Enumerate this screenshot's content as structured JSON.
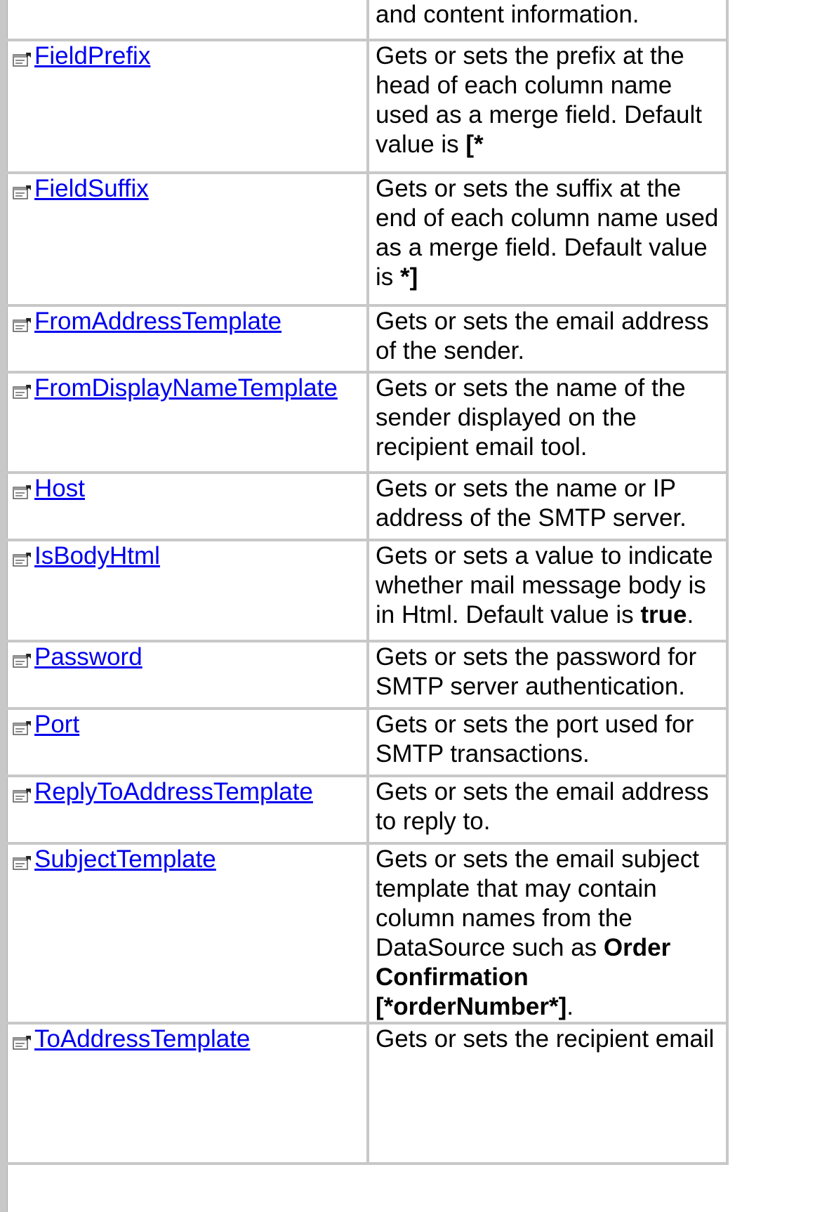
{
  "rows": [
    {
      "name": "",
      "desc": [
        {
          "t": "and content information."
        }
      ]
    },
    {
      "name": "FieldPrefix",
      "desc": [
        {
          "t": "Gets or sets the prefix at the head of each column name used as a merge field. Default value is "
        },
        {
          "t": "[*",
          "b": true
        }
      ]
    },
    {
      "name": "FieldSuffix",
      "desc": [
        {
          "t": "Gets or sets the suffix at the end of each column name used as a merge field. Default value is "
        },
        {
          "t": "*]",
          "b": true
        }
      ]
    },
    {
      "name": "FromAddressTemplate",
      "desc": [
        {
          "t": "Gets or sets the email address of the sender."
        }
      ]
    },
    {
      "name": "FromDisplayNameTemplate",
      "desc": [
        {
          "t": "Gets or sets the name of the sender displayed on the recipient email tool."
        }
      ]
    },
    {
      "name": "Host",
      "desc": [
        {
          "t": "Gets or sets the name or IP address of the SMTP server."
        }
      ]
    },
    {
      "name": "IsBodyHtml",
      "desc": [
        {
          "t": "Gets or sets a value to indicate whether mail message body is in Html. Default value is "
        },
        {
          "t": "true",
          "b": true
        },
        {
          "t": "."
        }
      ]
    },
    {
      "name": "Password",
      "desc": [
        {
          "t": "Gets or sets the password for SMTP server authentication."
        }
      ]
    },
    {
      "name": "Port",
      "desc": [
        {
          "t": "Gets or sets the port used for SMTP transactions."
        }
      ]
    },
    {
      "name": "ReplyToAddressTemplate",
      "desc": [
        {
          "t": "Gets or sets the email address to reply to."
        }
      ]
    },
    {
      "name": "SubjectTemplate",
      "desc": [
        {
          "t": "Gets or sets the email subject template that may contain column names from the DataSource such as "
        },
        {
          "t": "Order Confirmation [*orderNumber*]",
          "b": true
        },
        {
          "t": "."
        }
      ]
    },
    {
      "name": "ToAddressTemplate",
      "desc": [
        {
          "t": "Gets or sets the recipient email"
        }
      ]
    }
  ],
  "icon": "property-icon"
}
